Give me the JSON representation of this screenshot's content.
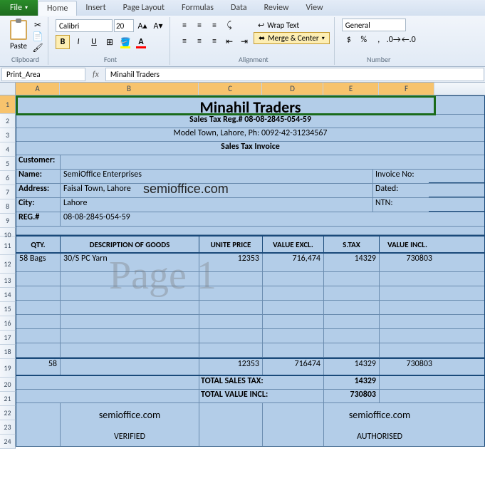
{
  "tabs": {
    "file": "File",
    "home": "Home",
    "insert": "Insert",
    "pagelayout": "Page Layout",
    "formulas": "Formulas",
    "data": "Data",
    "review": "Review",
    "view": "View"
  },
  "ribbon": {
    "clipboard": {
      "paste": "Paste",
      "label": "Clipboard"
    },
    "font": {
      "name": "Calibri",
      "size": "20",
      "label": "Font"
    },
    "alignment": {
      "wrap": "Wrap Text",
      "merge": "Merge & Center",
      "label": "Alignment"
    },
    "number": {
      "format": "General",
      "label": "Number"
    }
  },
  "namebox": "Print_Area",
  "fx": "fx",
  "formula_value": "Minahil Traders",
  "cols": [
    "A",
    "B",
    "C",
    "D",
    "E",
    "F"
  ],
  "rows": [
    "1",
    "2",
    "3",
    "4",
    "5",
    "6",
    "7",
    "8",
    "9",
    "10",
    "11",
    "12",
    "13",
    "14",
    "15",
    "16",
    "17",
    "18",
    "19",
    "20",
    "21",
    "22",
    "23",
    "24"
  ],
  "doc": {
    "title": "Minahil Traders",
    "reg_line": "Sales Tax Reg.# 08-08-2845-054-59",
    "addr_line": "Model Town, Lahore, Ph: 0092-42-31234567",
    "invoice_title": "Sales Tax Invoice",
    "customer_label": "Customer:",
    "name_label": "Name:",
    "name_value": "SemiOffice Enterprises",
    "address_label": "Address:",
    "address_value": "Faisal Town, Lahore",
    "city_label": "City:",
    "city_value": "Lahore",
    "regno_label": "REG.#",
    "regno_value": "08-08-2845-054-59",
    "invno_label": "Invoice No:",
    "dated_label": "Dated:",
    "ntn_label": "NTN:",
    "headers": {
      "qty": "QTY.",
      "desc": "DESCRIPTION OF GOODS",
      "uprice": "UNITE PRICE",
      "vexcl": "VALUE EXCL.",
      "stax": "S.TAX",
      "vincl": "VALUE INCL."
    },
    "items": [
      {
        "qty": "58 Bags",
        "desc": "30/S PC Yarn",
        "uprice": "12353",
        "vexcl": "716,474",
        "stax": "14329",
        "vincl": "730803"
      }
    ],
    "totals_row": {
      "qty": "58",
      "uprice": "12353",
      "vexcl": "716474",
      "stax": "14329",
      "vincl": "730803"
    },
    "total_stax_label": "TOTAL SALES TAX:",
    "total_stax_value": "14329",
    "total_vincl_label": "TOTAL VALUE INCL:",
    "total_vincl_value": "730803",
    "semi1": "semioffice.com",
    "semi2": "semioffice.com",
    "semi_inline": "semioffice.com",
    "verified": "VERIFIED",
    "authorised": "AUTHORISED",
    "watermark": "Page 1"
  }
}
